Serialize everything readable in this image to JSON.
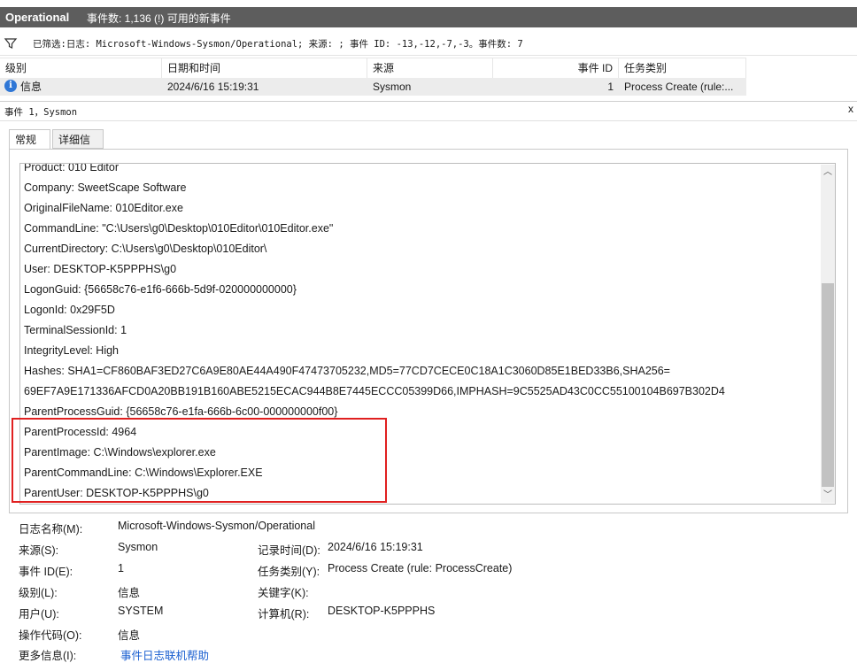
{
  "titlebar": {
    "name": "Operational",
    "count": "事件数: 1,136 (!) 可用的新事件"
  },
  "filter": {
    "text": "已筛选:日志: Microsoft-Windows-Sysmon/Operational; 来源: ; 事件 ID: -13,-12,-7,-3。事件数: 7"
  },
  "grid": {
    "headers": [
      "级别",
      "日期和时间",
      "来源",
      "事件 ID",
      "任务类别"
    ],
    "row": {
      "level": "信息",
      "datetime": "2024/6/16 15:19:31",
      "source": "Sysmon",
      "event_id": "1",
      "task": "Process Create (rule:..."
    }
  },
  "event_header": {
    "title": "事件 1，Sysmon",
    "close": "x"
  },
  "tabs": [
    "常规",
    "详细信息"
  ],
  "details": [
    "Product: 010 Editor",
    "Company: SweetScape Software",
    "OriginalFileName: 010Editor.exe",
    "CommandLine: \"C:\\Users\\g0\\Desktop\\010Editor\\010Editor.exe\"",
    "CurrentDirectory: C:\\Users\\g0\\Desktop\\010Editor\\",
    "User: DESKTOP-K5PPPHS\\g0",
    "LogonGuid: {56658c76-e1f6-666b-5d9f-020000000000}",
    "LogonId: 0x29F5D",
    "TerminalSessionId: 1",
    "IntegrityLevel: High",
    "Hashes: SHA1=CF860BAF3ED27C6A9E80AE44A490F47473705232,MD5=77CD7CECE0C18A1C3060D85E1BED33B6,SHA256=",
    "69EF7A9E171336AFCD0A20BB191B160ABE5215ECAC944B8E7445ECCC05399D66,IMPHASH=9C5525AD43C0CC55100104B697B302D4",
    "ParentProcessGuid: {56658c76-e1fa-666b-6c00-000000000f00}",
    "ParentProcessId: 4964",
    "ParentImage: C:\\Windows\\explorer.exe",
    "ParentCommandLine: C:\\Windows\\Explorer.EXE",
    "ParentUser: DESKTOP-K5PPPHS\\g0"
  ],
  "scroll": {
    "up": "︿",
    "down": "﹀"
  },
  "props": {
    "logname_label": "日志名称(M):",
    "logname_value": "Microsoft-Windows-Sysmon/Operational",
    "source_label": "来源(S):",
    "source_value": "Sysmon",
    "logged_label": "记录时间(D):",
    "logged_value": "2024/6/16 15:19:31",
    "eventid_label": "事件 ID(E):",
    "eventid_value": "1",
    "task_label": "任务类别(Y):",
    "task_value": "Process Create (rule: ProcessCreate)",
    "level_label": "级别(L):",
    "level_value": "信息",
    "keywords_label": "关键字(K):",
    "user_label": "用户(U):",
    "user_value": "SYSTEM",
    "computer_label": "计算机(R):",
    "computer_value": "DESKTOP-K5PPPHS",
    "opcode_label": "操作代码(O):",
    "opcode_value": "信息",
    "moreinfo_label": "更多信息(I):",
    "moreinfo_value": "事件日志联机帮助"
  },
  "colors": {
    "titlebar": "#5d5d5d",
    "highlight": "#e02020",
    "selected_row": "#ececec",
    "link": "#1a5fd0"
  }
}
